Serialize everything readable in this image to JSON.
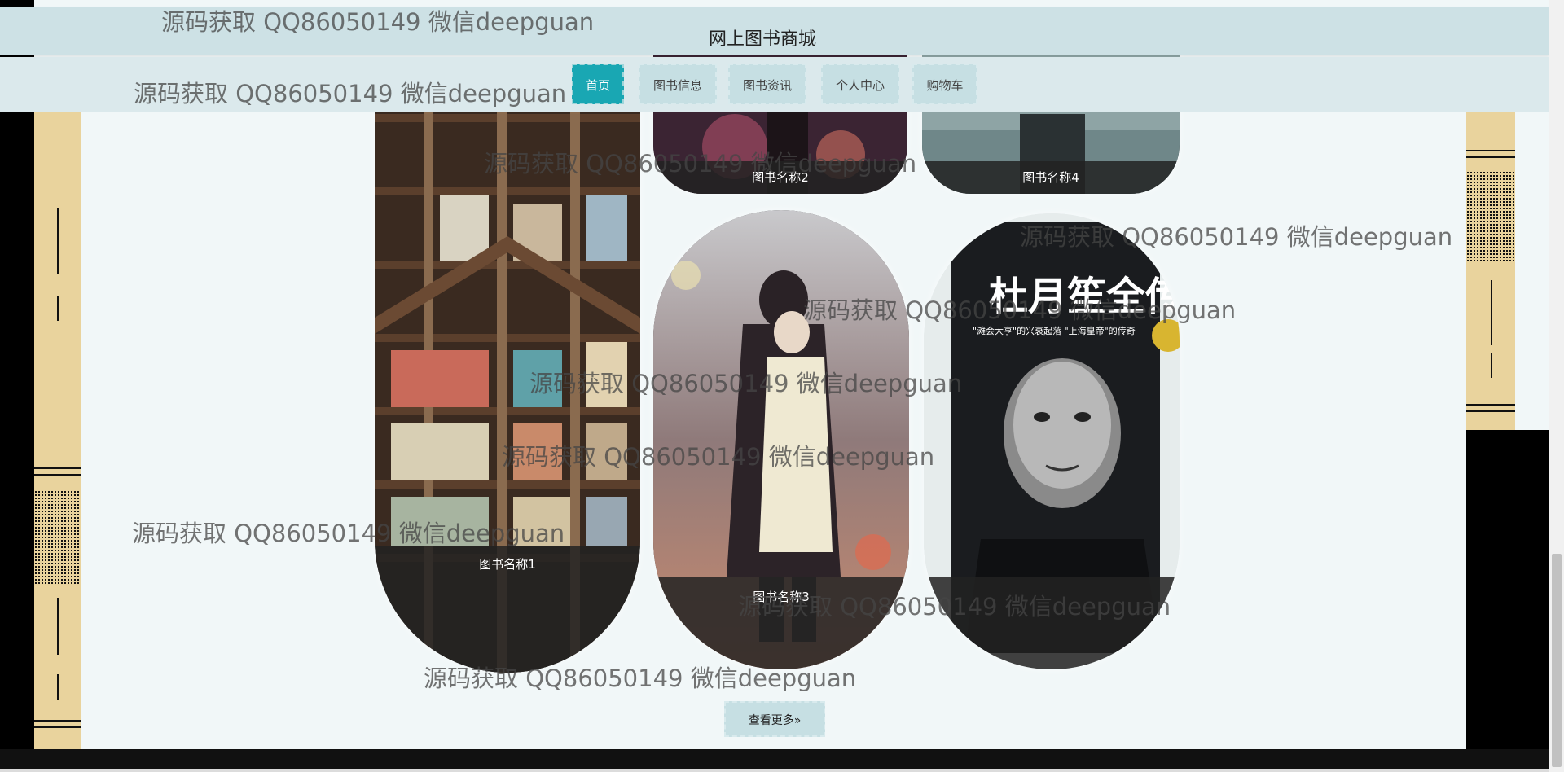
{
  "header": {
    "site_title": "网上图书商城"
  },
  "nav": {
    "items": [
      {
        "label": "首页",
        "active": true
      },
      {
        "label": "图书信息",
        "active": false
      },
      {
        "label": "图书资讯",
        "active": false
      },
      {
        "label": "个人中心",
        "active": false
      },
      {
        "label": "购物车",
        "active": false
      }
    ]
  },
  "books": [
    {
      "name": "图书名称1"
    },
    {
      "name": "图书名称2"
    },
    {
      "name": "图书名称3"
    },
    {
      "name": "图书名称4"
    },
    {
      "name": "杜月笙全传",
      "cover_text": "杜月笙全传",
      "cover_subtitle": "\"滩会大亨\"的兴衰起落 \"上海皇帝\"的传奇"
    }
  ],
  "more_button": {
    "label": "查看更多»"
  },
  "watermark": {
    "text": "源码获取 QQ86050149 微信deepguan"
  },
  "colors": {
    "accent": "#19a7b3",
    "header_bg": "#cde1e5",
    "nav_bg": "#dbe9ec",
    "deco_gold": "#e9d39d"
  }
}
